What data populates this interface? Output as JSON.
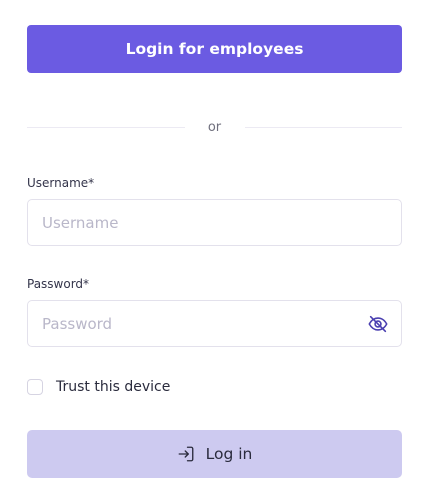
{
  "sso": {
    "button_label": "Login for employees"
  },
  "divider": {
    "text": "or"
  },
  "username": {
    "label": "Username*",
    "placeholder": "Username",
    "value": ""
  },
  "password": {
    "label": "Password*",
    "placeholder": "Password",
    "value": "",
    "toggle_icon": "eye-off-icon"
  },
  "trust": {
    "label": "Trust this device",
    "checked": false
  },
  "login": {
    "button_label": "Log in",
    "icon": "login-icon"
  },
  "colors": {
    "primary": "#6b5be2",
    "login_disabled": "#cdcaf0",
    "icon": "#4a3fb0"
  }
}
